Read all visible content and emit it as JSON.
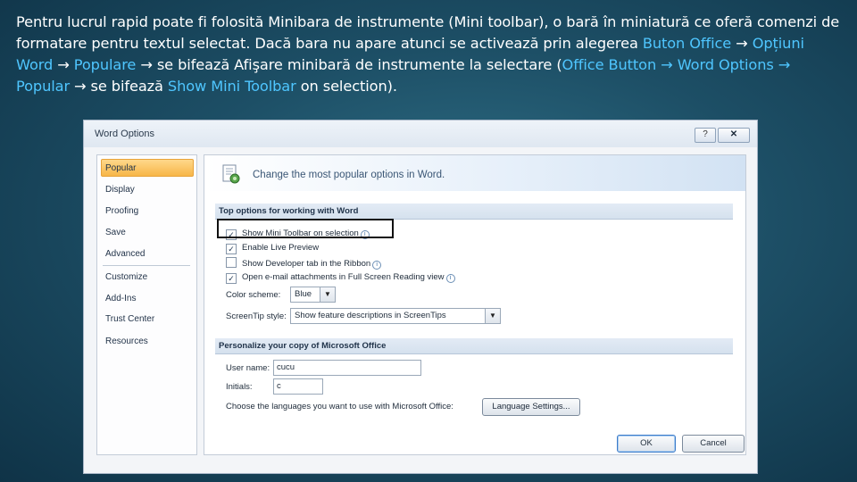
{
  "slide": {
    "text_1": "Pentru lucrul rapid poate fi folosită Minibara de instrumente (Mini toolbar), o bară în miniatură ce oferă comenzi de formatare pentru textul selectat. Dacă bara nu apare atunci se activează prin alegerea ",
    "buton_office": "Buton Office",
    "arrow_1": " → ",
    "optiuni_word": "Opțiuni Word",
    "arrow_2": " → ",
    "populare": "Populare",
    "text_2": " → se bifează Afişare minibară de instrumente la selectare (",
    "office_button": "Office Button",
    "arrow_3": " → ",
    "word_options": "Word Options",
    "arrow_4": " → ",
    "popular": "Popular",
    "text_3": " → se bifează ",
    "show_mini_toolbar": "Show Mini Toolbar",
    "text_4": " on selection).",
    "highlight_color": "#4fc6ff"
  },
  "dialog": {
    "title": "Word Options",
    "help_label": "?",
    "close_label": "✕",
    "nav": [
      "Popular",
      "Display",
      "Proofing",
      "Save",
      "Advanced",
      "Customize",
      "Add-Ins",
      "Trust Center",
      "Resources"
    ],
    "header_text": "Change the most popular options in Word.",
    "section_top": "Top options for working with Word",
    "options": [
      {
        "label": "Show Mini Toolbar on selection",
        "checked": "✓"
      },
      {
        "label": "Enable Live Preview",
        "checked": "✓"
      },
      {
        "label": "Show Developer tab in the Ribbon",
        "checked": ""
      },
      {
        "label": "Open e-mail attachments in Full Screen Reading view",
        "checked": "✓"
      }
    ],
    "color_scheme_label": "Color scheme:",
    "color_scheme_value": "Blue",
    "screentip_label": "ScreenTip style:",
    "screentip_value": "Show feature descriptions in ScreenTips",
    "section_personalize": "Personalize your copy of Microsoft Office",
    "user_name_label": "User name:",
    "user_name_value": "cucu",
    "initials_label": "Initials:",
    "initials_value": "c",
    "languages_label": "Choose the languages you want to use with Microsoft Office:",
    "language_button": "Language Settings...",
    "ok_label": "OK",
    "cancel_label": "Cancel",
    "active_nav_color": "#f7b648"
  }
}
